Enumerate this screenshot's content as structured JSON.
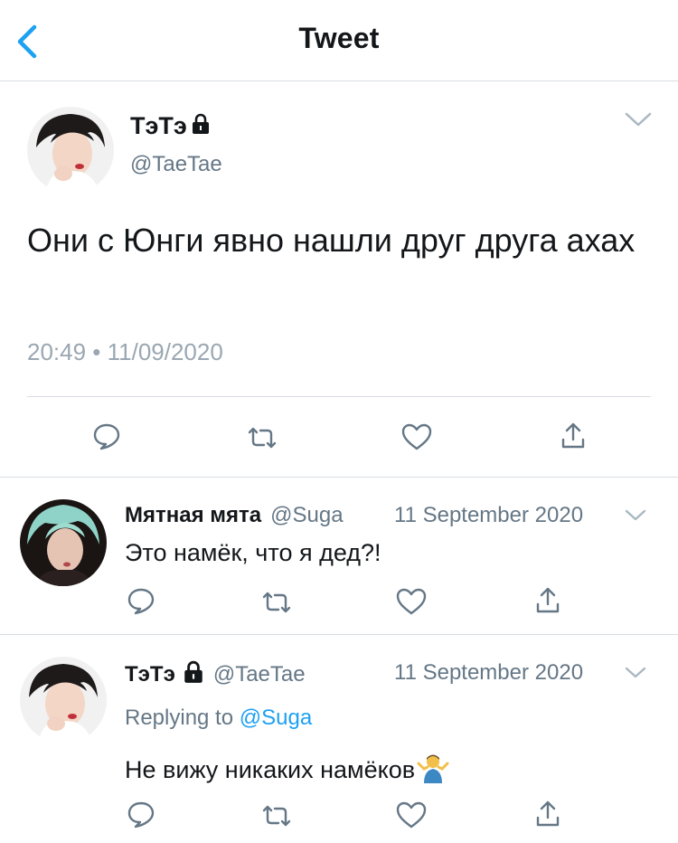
{
  "header": {
    "title": "Tweet",
    "accent_color": "#1da1f2"
  },
  "main_tweet": {
    "author_name": "ТэТэ",
    "author_handle": "@TaeTae",
    "text": "Они с Юнги явно нашли друг друга ахах",
    "timestamp": "20:49 • 11/09/2020"
  },
  "replies": [
    {
      "author_name": "Мятная мята",
      "author_handle": "@Suga",
      "date": "11 September 2020",
      "text": "Это намёк, что я дед?!"
    },
    {
      "author_name": "ТэТэ",
      "author_handle": "@TaeTae",
      "date": "11 September 2020",
      "replying_prefix": "Replying to",
      "replying_mention": "@Suga",
      "text": "Не вижу никаких намёков"
    }
  ],
  "icons": [
    "back-chevron-icon",
    "lock-icon",
    "chevron-down-icon",
    "reply-icon",
    "retweet-icon",
    "like-icon",
    "share-icon",
    "shrug-emoji-icon"
  ]
}
